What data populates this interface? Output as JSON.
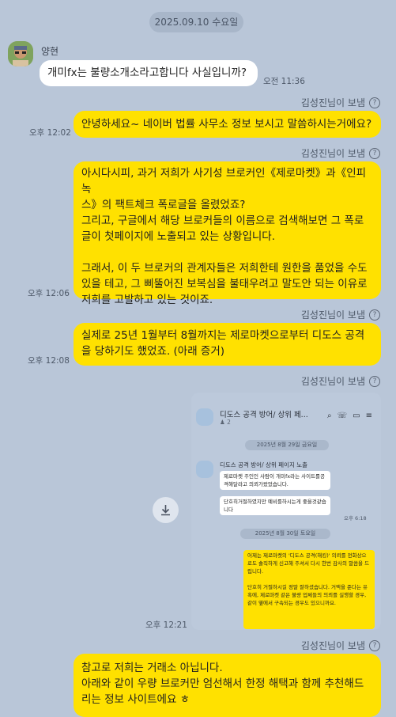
{
  "date_chip": "2025.09.10 수요일",
  "sender": {
    "name": "양현"
  },
  "incoming": {
    "text": "개미fx는 불량소개소라고합니다 사실입니까?",
    "time": "오전 11:36"
  },
  "messages": [
    {
      "sent_by": "김성진님이 보냄",
      "text": "안녕하세요~ 네이버 법률 사무소 정보 보시고 말씀하시는거에요?",
      "time": "오후 12:02"
    },
    {
      "sent_by": "김성진님이 보냄",
      "text": "아시다시피, 과거 저희가 사기성 브로커인《제로마켓》과《인피녹\n스》의 팩트체크 폭로글을 올렸었죠?\n그리고, 구글에서 해당 브로커들의 이름으로 검색해보면 그 폭로\n글이 첫페이지에 노출되고 있는 상황입니다.\n\n그래서, 이 두 브로커의 관계자들은 저희한테 원한을 품었을 수도\n있을 테고, 그 삐뚤어진 보복심을 불태우려고 말도안 되는 이유로\n저희를 고발하고 있는 것이죠.",
      "time": "오후 12:06"
    },
    {
      "sent_by": "김성진님이 보냄",
      "text": "실제로 25년 1월부터 8월까지는 제로마켓으로부터 디도스 공격\n을 당하기도 했었죠. (아래 증거)",
      "time": "오후 12:08"
    },
    {
      "sent_by": "김성진님이 보냄",
      "time": "오후 12:21"
    },
    {
      "sent_by": "김성진님이 보냄",
      "text": "참고로 저희는 거래소 아닙니다.\n아래와 같이 우량 브로커만 엄선해서 한정 해택과 함께 추천해드\n리는 정보 사이트에요 ㅎ"
    }
  ],
  "screenshot": {
    "title": "디도스 공격 방어/ 상위 페...",
    "member_count": "2",
    "date1": "2025년 8월 29일 금요일",
    "sender_name": "디도스 공격 방어/ 상위 페이지 노출",
    "msg1": "제로마켓 주인인 사람이 개미fx라는 사이트를공격해달라고 의뢰가왔었습니다.",
    "msg2": "단호히거절하였지만 예비를하시는게 좋을것같습니다",
    "time1": "오후 6:18",
    "date2": "2025년 8월 30일 토요일",
    "msg3": "어제는 제로마켓의 '디도스 공격(해킹)' 의뢰를 전화상으로도 솔직하게 신고해 주셔서 다시 한번 감사의 말씀을 드립니다.\n\n단호히 거절하시길 정말 잘하셨습니다. 거액을 준다는 유혹에, 제로마켓 같은 불량 업체들의 의뢰를 실행할 경우, 같이 옆에서 구속되는 경우도 있으니까요."
  },
  "icons": [
    "download-icon",
    "help-circle-icon",
    "search-icon",
    "phone-icon",
    "video-icon",
    "menu-icon",
    "person-icon"
  ],
  "colors": {
    "background": "#b9c6d8",
    "outgoing_bubble": "#ffe100",
    "incoming_bubble": "#ffffff"
  }
}
